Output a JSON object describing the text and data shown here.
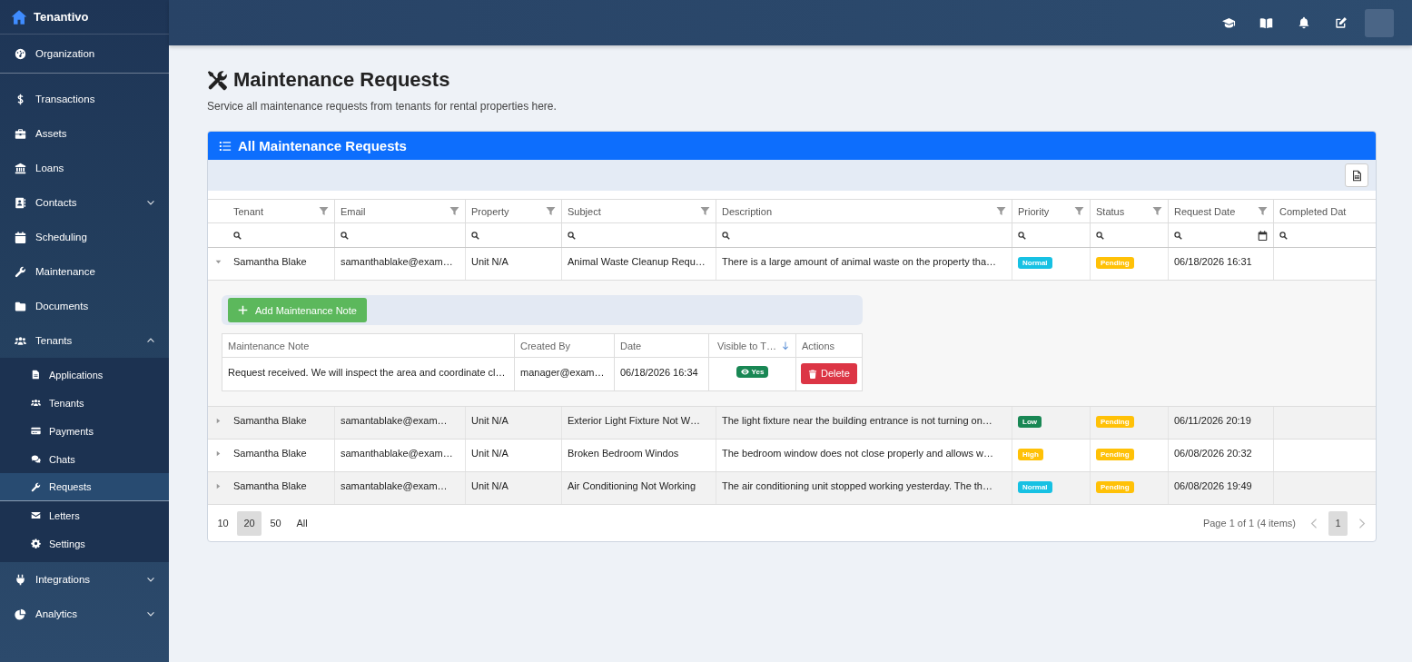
{
  "sidebar": {
    "brand": "Tenantivo",
    "organization": {
      "label": "Organization",
      "selected": false
    },
    "items": [
      {
        "label": "Transactions",
        "selected": false
      },
      {
        "label": "Assets",
        "selected": false
      },
      {
        "label": "Loans",
        "selected": false
      },
      {
        "label": "Contacts",
        "selected": false,
        "expanded": false
      },
      {
        "label": "Scheduling",
        "selected": false
      },
      {
        "label": "Maintenance",
        "selected": false
      },
      {
        "label": "Documents",
        "selected": false
      },
      {
        "label": "Tenants",
        "selected": false,
        "expanded": true,
        "children": [
          {
            "label": "Applications",
            "selected": false
          },
          {
            "label": "Tenants",
            "selected": false
          },
          {
            "label": "Payments",
            "selected": false
          },
          {
            "label": "Chats",
            "selected": false
          },
          {
            "label": "Requests",
            "selected": true
          },
          {
            "label": "Letters",
            "selected": false
          },
          {
            "label": "Settings",
            "selected": false
          }
        ]
      },
      {
        "label": "Integrations",
        "selected": false,
        "expanded": false
      },
      {
        "label": "Analytics",
        "selected": false,
        "expanded": false
      }
    ]
  },
  "page": {
    "title": "Maintenance Requests",
    "subtitle": "Service all maintenance requests from tenants for rental properties here."
  },
  "card": {
    "title": "All Maintenance Requests",
    "table": {
      "columns": [
        {
          "label": "Tenant",
          "kind": "text",
          "filterable": true
        },
        {
          "label": "Email",
          "kind": "text",
          "filterable": true
        },
        {
          "label": "Property",
          "kind": "text",
          "filterable": true
        },
        {
          "label": "Subject",
          "kind": "text",
          "filterable": true
        },
        {
          "label": "Description",
          "kind": "text",
          "filterable": true
        },
        {
          "label": "Priority",
          "kind": "priority",
          "filterable": true
        },
        {
          "label": "Status",
          "kind": "status",
          "filterable": true
        },
        {
          "label": "Request Date",
          "kind": "date",
          "filterable": true
        },
        {
          "label": "Completed Dat",
          "kind": "text",
          "filterable": false
        }
      ],
      "rows": [
        {
          "expanded": true,
          "cells": [
            "Samantha Blake",
            "samanthablake@exam…",
            "Unit N/A",
            "Animal Waste Cleanup Requ…",
            "There is a large amount of animal waste on the property tha…",
            {
              "label": "Normal",
              "color": "#17c1e3"
            },
            {
              "label": "Pending",
              "color": "#ffc107"
            },
            "06/18/2026 16:31"
          ],
          "detail": {
            "add_button": "Add Maintenance Note",
            "columns": [
              {
                "label": "Maintenance Note",
                "kind": "text",
                "sorted": false
              },
              {
                "label": "Created By",
                "kind": "text",
                "sorted": false
              },
              {
                "label": "Date",
                "kind": "text",
                "sorted": false
              },
              {
                "label": "Visible to T…",
                "kind": "flag",
                "sorted": true
              },
              {
                "label": "Actions",
                "kind": "action",
                "sorted": false
              }
            ],
            "rows": [
              {
                "cells": [
                  "Request received. We will inspect the area and coordinate cl…",
                  "manager@exam…",
                  "06/18/2026 16:34",
                  {
                    "label": "Yes",
                    "color": "#198754"
                  },
                  "Delete"
                ]
              }
            ]
          }
        },
        {
          "expanded": false,
          "cells": [
            "Samantha Blake",
            "samantablake@exam…",
            "Unit N/A",
            "Exterior Light Fixture Not W…",
            "The light fixture near the building entrance is not turning on…",
            {
              "label": "Low",
              "color": "#198754"
            },
            {
              "label": "Pending",
              "color": "#ffc107"
            },
            "06/11/2026 20:19"
          ]
        },
        {
          "expanded": false,
          "cells": [
            "Samantha Blake",
            "samanthablake@exam…",
            "Unit N/A",
            "Broken Bedroom Windos",
            "The bedroom window does not close properly and allows w…",
            {
              "label": "High",
              "color": "#ffc107"
            },
            {
              "label": "Pending",
              "color": "#ffc107"
            },
            "06/08/2026 20:32"
          ]
        },
        {
          "expanded": false,
          "cells": [
            "Samantha Blake",
            "samantablake@exam…",
            "Unit N/A",
            "Air Conditioning Not Working",
            "The air conditioning unit stopped working yesterday. The th…",
            {
              "label": "Normal",
              "color": "#17c1e3"
            },
            {
              "label": "Pending",
              "color": "#ffc107"
            },
            "06/08/2026 19:49"
          ]
        }
      ]
    },
    "pager": {
      "sizes": [
        {
          "label": "10",
          "selected": false
        },
        {
          "label": "20",
          "selected": true
        },
        {
          "label": "50",
          "selected": false
        },
        {
          "label": "All",
          "selected": false
        }
      ],
      "summary": "Page 1 of 1 (4 items)",
      "pages": [
        {
          "label": "1",
          "selected": true
        }
      ]
    }
  }
}
